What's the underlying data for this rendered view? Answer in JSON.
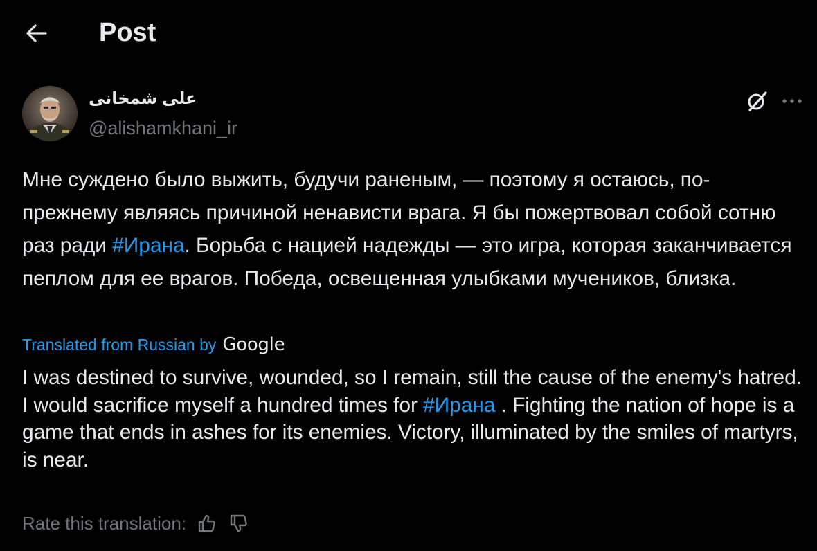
{
  "header": {
    "title": "Post",
    "back_icon": "arrow-left-icon"
  },
  "author": {
    "display_name": "علی شمخانی",
    "handle": "@alishamkhani_ir",
    "grok_icon": "grok-icon",
    "more_icon": "more-horizontal-icon"
  },
  "post": {
    "original_parts": {
      "before_hashtag": "Мне суждено было выжить, будучи раненым, — поэтому я остаюсь, по-прежнему являясь причиной ненависти врага. Я бы пожертвовал собой сотню раз ради ",
      "hashtag": "#Ирана",
      "after_hashtag": ". Борьба с нацией надежды — это игра, которая заканчивается пеплом для ее врагов. Победа, освещенная улыбками мучеников, близка."
    },
    "translation_label": "Translated from Russian by",
    "translation_provider": "Google",
    "translated_parts": {
      "before_hashtag": "I was destined to survive, wounded, so I remain, still the cause of the enemy's hatred. I would sacrifice myself a hundred times for ",
      "hashtag": "#Ирана",
      "after_hashtag": " . Fighting the nation of hope is a game that ends in ashes for its enemies. Victory, illuminated by the smiles of martyrs, is near."
    }
  },
  "rating": {
    "label": "Rate this translation:",
    "thumbs_up_icon": "thumbs-up-icon",
    "thumbs_down_icon": "thumbs-down-icon"
  },
  "colors": {
    "background": "#000000",
    "text": "#e7e9ea",
    "secondary": "#71767b",
    "accent": "#1d9bf0"
  }
}
